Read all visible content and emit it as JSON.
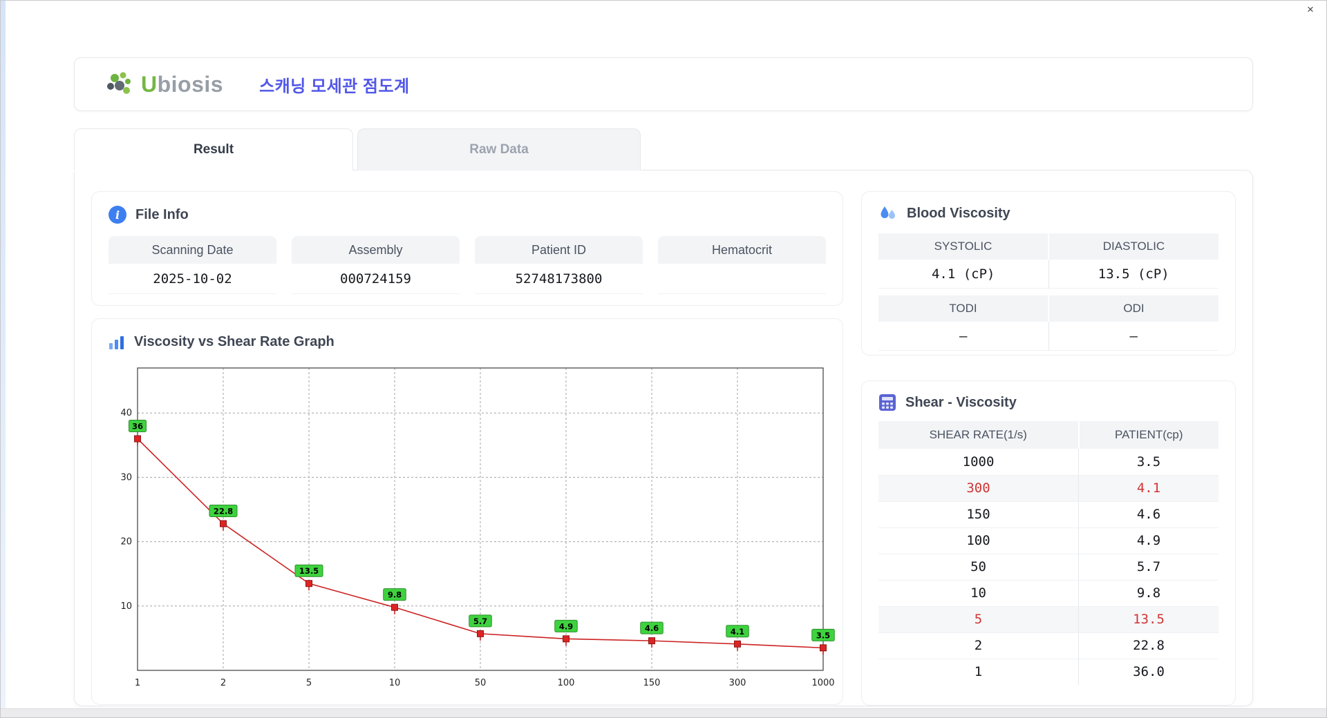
{
  "window": {
    "close_label": "×"
  },
  "header": {
    "logo_u": "U",
    "logo_rest": "biosis",
    "title": "스캐닝 모세관 점도계"
  },
  "tabs": [
    {
      "label": "Result",
      "active": true
    },
    {
      "label": "Raw Data",
      "active": false
    }
  ],
  "file_info": {
    "title": "File Info",
    "fields": [
      {
        "label": "Scanning Date",
        "value": "2025-10-02"
      },
      {
        "label": "Assembly",
        "value": "000724159"
      },
      {
        "label": "Patient ID",
        "value": "52748173800"
      },
      {
        "label": "Hematocrit",
        "value": ""
      }
    ]
  },
  "blood_viscosity": {
    "title": "Blood Viscosity",
    "rows": [
      {
        "cells": [
          {
            "label": "SYSTOLIC",
            "value": "4.1 (cP)"
          },
          {
            "label": "DIASTOLIC",
            "value": "13.5 (cP)"
          }
        ]
      },
      {
        "cells": [
          {
            "label": "TODI",
            "value": "–"
          },
          {
            "label": "ODI",
            "value": "–"
          }
        ]
      }
    ]
  },
  "graph": {
    "title": "Viscosity vs Shear Rate Graph"
  },
  "chart_data": {
    "type": "line",
    "title": "Viscosity vs Shear Rate Graph",
    "x_scale": "ordinal",
    "x": [
      "1",
      "2",
      "5",
      "10",
      "50",
      "100",
      "150",
      "300",
      "1000"
    ],
    "values": [
      36,
      22.8,
      13.5,
      9.8,
      5.7,
      4.9,
      4.6,
      4.1,
      3.5
    ],
    "labels": [
      "36",
      "22.8",
      "13.5",
      "9.8",
      "5.7",
      "4.9",
      "4.6",
      "4.1",
      "3.5"
    ],
    "xlabel": "",
    "ylabel": "",
    "ylim": [
      0,
      47
    ],
    "yticks": [
      10,
      20,
      30,
      40
    ],
    "grid": "dashed",
    "line_color": "#cc2222",
    "marker_color": "#dd2424",
    "marker_border": "#8e1515",
    "label_bg": "#3fd23f",
    "label_border": "#2a8f2a"
  },
  "shear_viscosity": {
    "title": "Shear - Viscosity",
    "columns": [
      "SHEAR RATE(1/s)",
      "PATIENT(cp)"
    ],
    "rows": [
      {
        "rate": "1000",
        "patient": "3.5",
        "highlight": false
      },
      {
        "rate": "300",
        "patient": "4.1",
        "highlight": true
      },
      {
        "rate": "150",
        "patient": "4.6",
        "highlight": false
      },
      {
        "rate": "100",
        "patient": "4.9",
        "highlight": false
      },
      {
        "rate": "50",
        "patient": "5.7",
        "highlight": false
      },
      {
        "rate": "10",
        "patient": "9.8",
        "highlight": false
      },
      {
        "rate": "5",
        "patient": "13.5",
        "highlight": true
      },
      {
        "rate": "2",
        "patient": "22.8",
        "highlight": false
      },
      {
        "rate": "1",
        "patient": "36.0",
        "highlight": false
      }
    ]
  },
  "colors": {
    "accent_blue": "#5157e8",
    "highlight_red": "#d03535",
    "point_label_green": "#3fd23f"
  }
}
